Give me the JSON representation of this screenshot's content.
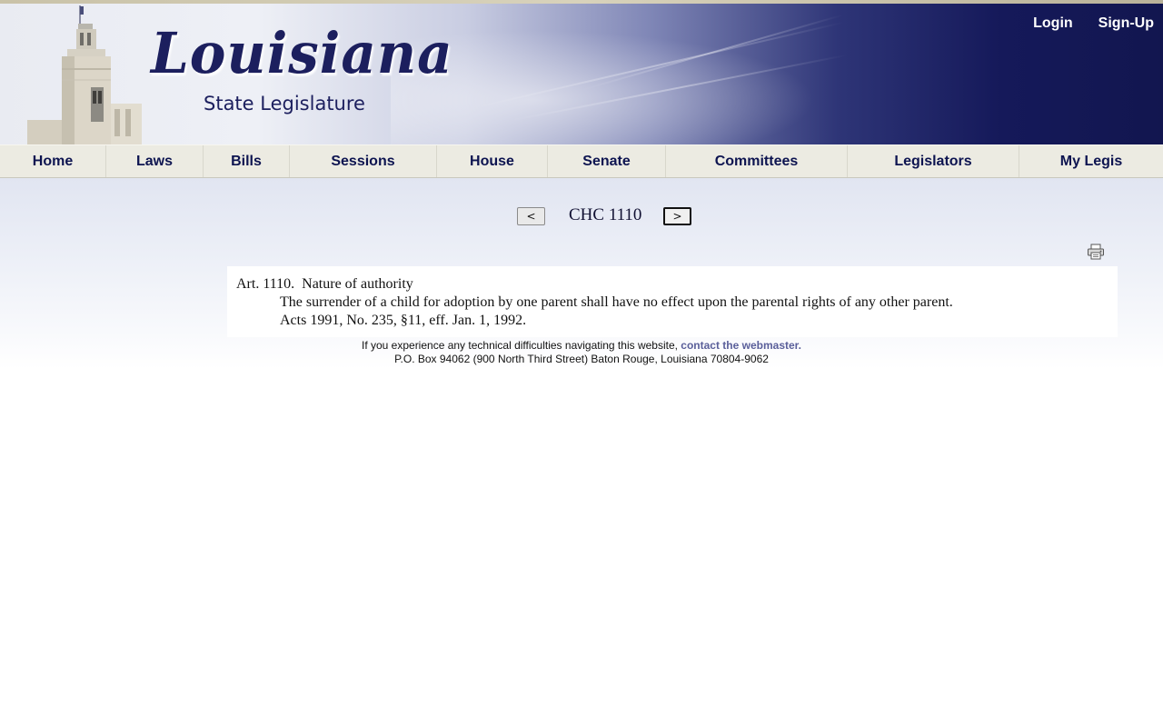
{
  "header": {
    "logo_word": "Louisiana",
    "logo_sub": "State Legislature",
    "login_label": "Login",
    "signup_label": "Sign-Up"
  },
  "nav": {
    "items": [
      "Home",
      "Laws",
      "Bills",
      "Sessions",
      "House",
      "Senate",
      "Committees",
      "Legislators",
      "My Legis"
    ]
  },
  "pager": {
    "prev_label": "<",
    "next_label": ">",
    "title": "CHC 1110"
  },
  "law": {
    "title": "Art. 1110.  Nature of authority",
    "text": "The surrender of a child for adoption by one parent shall have no effect upon the parental rights of any other parent.",
    "history": "Acts 1991, No. 235, §11, eff. Jan. 1, 1992."
  },
  "footer": {
    "notice": "If you experience any technical difficulties navigating this website, ",
    "contact_link": "contact the webmaster.",
    "address": "P.O. Box 94062 (900 North Third Street) Baton Rouge, Louisiana 70804-9062"
  },
  "icons": {
    "print": "printer-icon",
    "capitol": "capitol-building-icon"
  },
  "colors": {
    "brand_navy": "#15195a",
    "nav_text": "#0d1450",
    "nav_bg": "#ecebe2",
    "link": "#5a5f9a"
  }
}
